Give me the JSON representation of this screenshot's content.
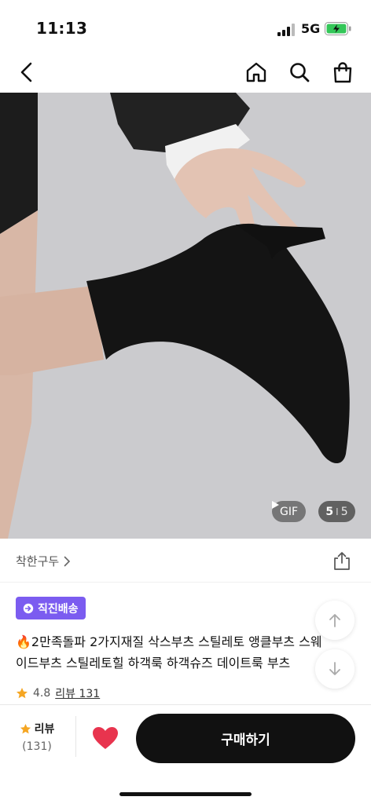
{
  "status": {
    "time": "11:13",
    "network": "5G"
  },
  "hero": {
    "gif_label": "GIF",
    "current_page": "5",
    "separator": "I",
    "total_pages": "5"
  },
  "store": {
    "name": "착한구두"
  },
  "product": {
    "badge": "직진배송",
    "title_line1": "🔥2만족돌파 2가지재질 삭스부츠 스틸레토 앵클부츠 스웨",
    "title_line2": "이드부츠 스틸레토힐 하객룩 하객슈즈 데이트룩 부츠",
    "rating": "4.8",
    "review_link": "리뷰 131"
  },
  "bottom": {
    "review_label": "리뷰",
    "review_count": "(131)",
    "buy_label": "구매하기"
  },
  "colors": {
    "accent": "#7b5cf0",
    "star": "#f5a623",
    "heart": "#e8344e",
    "buy_bg": "#111111"
  }
}
